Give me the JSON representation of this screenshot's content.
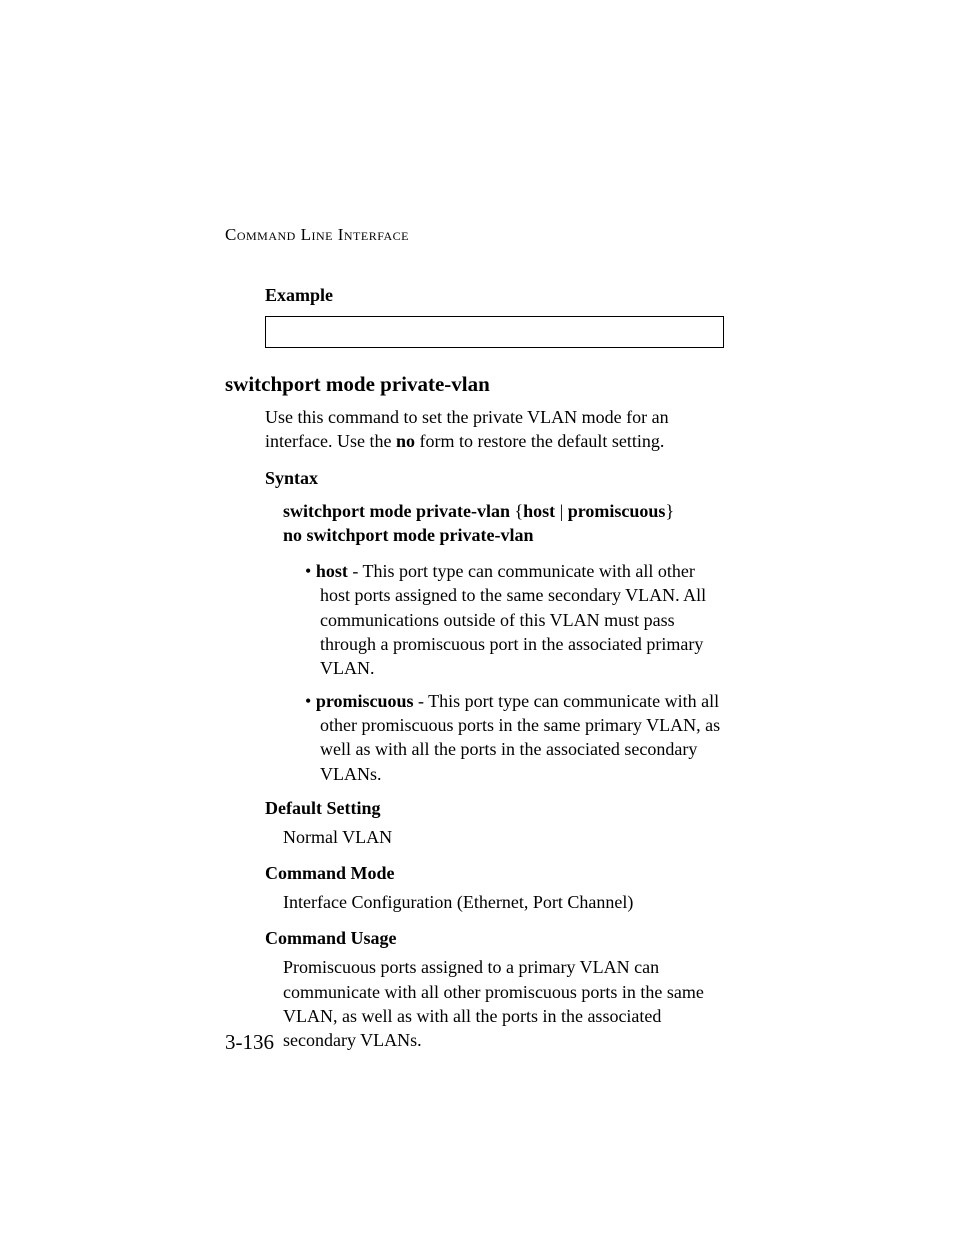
{
  "running_head": "Command Line Interface",
  "example_heading": "Example",
  "section_title": "switchport mode private-vlan",
  "intro_part1": "Use this command to set the private VLAN mode for an interface. Use the ",
  "intro_bold": "no",
  "intro_part2": " form to restore the default setting.",
  "syntax_heading": "Syntax",
  "syntax_line1_b1": "switchport mode private-vlan",
  "syntax_line1_plain1": " {",
  "syntax_line1_b2": "host",
  "syntax_line1_plain2": " | ",
  "syntax_line1_b3": "promiscuous",
  "syntax_line1_plain3": "}",
  "syntax_line2": "no switchport mode private-vlan",
  "bullet1_term": "host",
  "bullet1_text": " - This port type can communicate with all other host ports assigned to the same secondary VLAN. All communications outside of this VLAN must pass through a promiscuous port in the associated primary VLAN.",
  "bullet2_term": "promiscuous",
  "bullet2_text": " - This port type can communicate with all other promiscuous ports in the same primary VLAN, as well as with all the ports in the associated secondary VLANs.",
  "default_heading": "Default Setting",
  "default_value": "Normal VLAN",
  "mode_heading": "Command Mode",
  "mode_value": "Interface Configuration (Ethernet, Port Channel)",
  "usage_heading": "Command Usage",
  "usage_text": "Promiscuous ports assigned to a primary VLAN can communicate with all other promiscuous ports in the same VLAN, as well as with all the ports in the associated secondary VLANs.",
  "page_number": "3-136"
}
